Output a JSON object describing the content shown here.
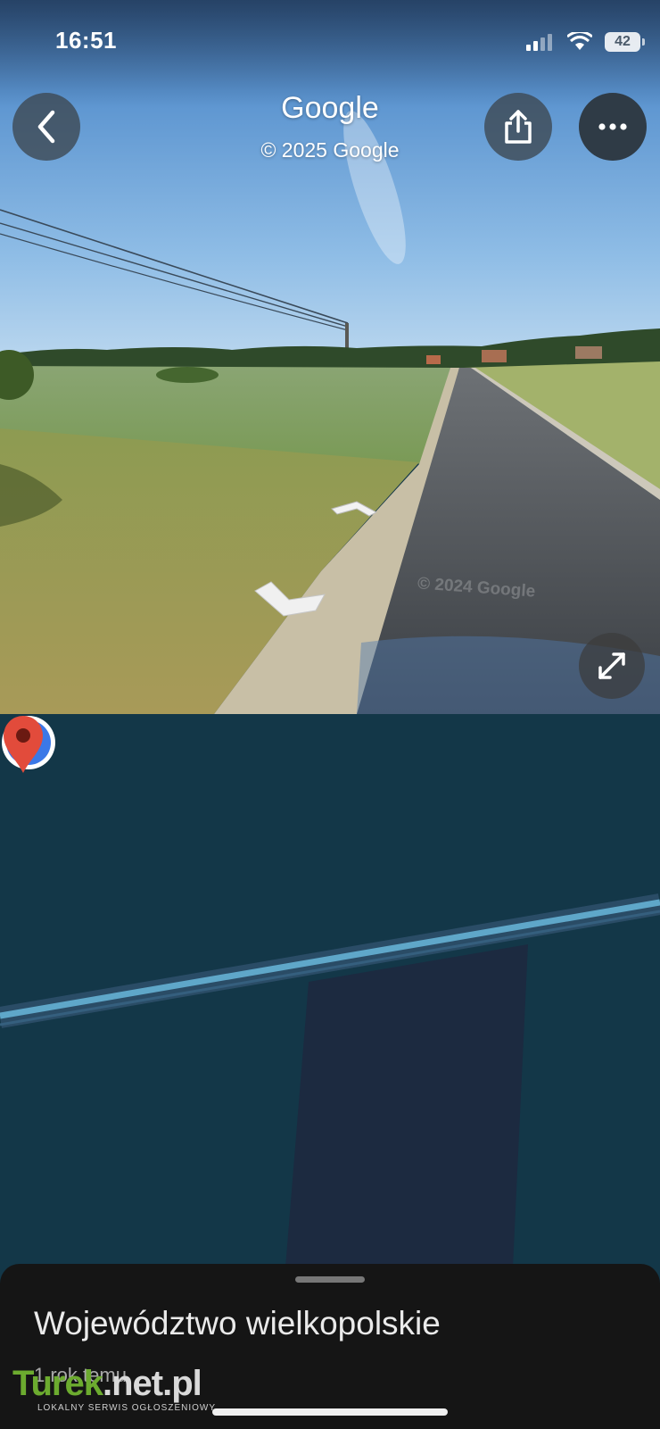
{
  "status_bar": {
    "time": "16:51",
    "battery": "42",
    "icons": [
      "signal-icon",
      "wifi-icon",
      "battery-icon"
    ]
  },
  "street_view": {
    "title": "Google",
    "copyright": "© 2025 Google",
    "imagery_watermark": "© 2024 Google",
    "buttons": [
      "back-icon",
      "share-icon",
      "more-icon",
      "expand-icon"
    ]
  },
  "map": {
    "colors": {
      "background": "#133748",
      "road": "#5fa7c9",
      "coverage": "#1c2a40",
      "pin": "#e24b3b",
      "location": "#3b78e7"
    }
  },
  "place": {
    "name": "Województwo wielkopolskie",
    "age": "1 rok temu"
  },
  "watermark_logo": {
    "brand_green": "Turek",
    "brand_rest": ".net.pl",
    "tagline": "LOKALNY SERWIS OGŁOSZENIOWY"
  }
}
